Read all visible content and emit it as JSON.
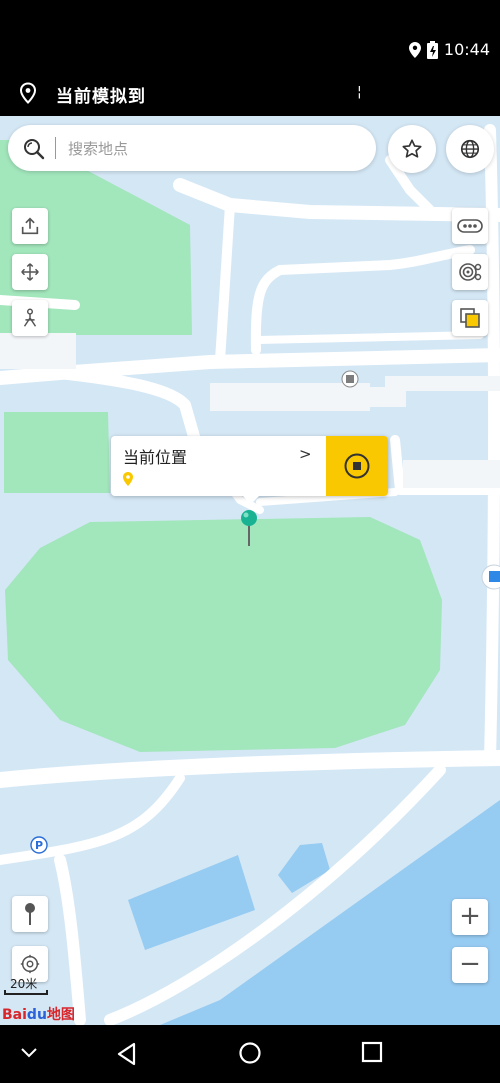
{
  "status_bar": {
    "time": "10:44"
  },
  "app_bar": {
    "title": "当前模拟到",
    "mark": "¦"
  },
  "search": {
    "placeholder": "搜索地点"
  },
  "callout": {
    "title": "当前位置",
    "chevron": ">"
  },
  "zoom": {
    "in_label": "+",
    "out_label": "−"
  },
  "map": {
    "scale_label": "20米",
    "logo_text": "Bai",
    "logo_text2": "地图",
    "logo_du": "du"
  },
  "icons": [
    "location-pin-icon",
    "battery-icon",
    "search-icon",
    "star-icon",
    "globe-icon",
    "share-icon",
    "move-icon",
    "route-icon",
    "more-icon",
    "traffic-icon",
    "layers-icon",
    "stop-icon",
    "parking-icon",
    "pin-tool-icon",
    "locate-icon",
    "back-nav-icon",
    "home-nav-icon",
    "recents-nav-icon",
    "collapse-icon"
  ],
  "colors": {
    "map_water": "#d4e7f5",
    "map_green": "#a2e6bc",
    "map_sea": "#96cbf2",
    "accent_yellow": "#f9c800",
    "marker_teal": "#19b394"
  }
}
